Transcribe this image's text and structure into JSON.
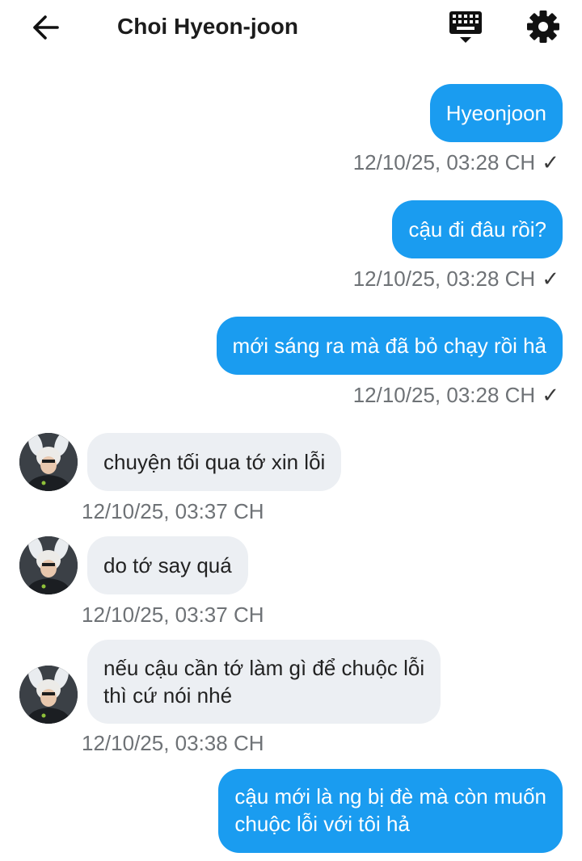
{
  "header": {
    "title": "Choi Hyeon-joon",
    "back_icon": "arrow-left-icon",
    "keyboard_icon": "keyboard-icon",
    "settings_icon": "gear-icon"
  },
  "colors": {
    "outgoing_bubble": "#1a9cf0",
    "incoming_bubble": "#eceff3",
    "timestamp": "#6e7276"
  },
  "messages": [
    {
      "direction": "outgoing",
      "text": "Hyeonjoon",
      "time": "12/10/25, 03:28 CH",
      "status": "✓"
    },
    {
      "direction": "outgoing",
      "text": "cậu đi đâu rồi?",
      "time": "12/10/25, 03:28 CH",
      "status": "✓"
    },
    {
      "direction": "outgoing",
      "text": "mới sáng ra mà đã bỏ chạy rồi hả",
      "time": "12/10/25, 03:28 CH",
      "status": "✓"
    },
    {
      "direction": "incoming",
      "text": "chuyện tối qua tớ xin lỗi",
      "time": "12/10/25, 03:37 CH"
    },
    {
      "direction": "incoming",
      "text": "do tớ say quá",
      "time": "12/10/25, 03:37 CH"
    },
    {
      "direction": "incoming",
      "lines": [
        "nếu cậu cần tớ làm gì để chuộc lỗi",
        "thì cứ nói nhé"
      ],
      "time": "12/10/25, 03:38 CH"
    },
    {
      "direction": "outgoing",
      "lines": [
        "cậu mới là ng bị đè mà còn muốn",
        "chuộc lỗi với tôi hả"
      ]
    }
  ]
}
